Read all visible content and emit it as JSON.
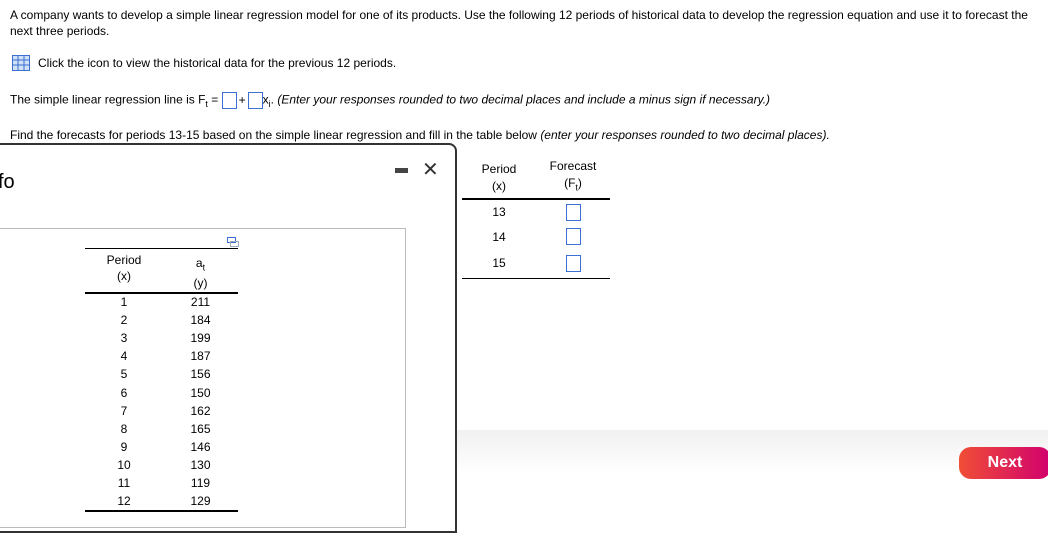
{
  "question": {
    "text": "A company wants to develop a simple linear regression model for one of its products. Use the following 12 periods of historical data to develop the regression equation and use it to forecast the next three periods."
  },
  "data_link": {
    "icon": "table-grid-icon",
    "text": "Click the icon to view the historical data for the previous 12 periods."
  },
  "regression": {
    "prefix": "The simple linear regression line is F",
    "sub_t": "t",
    "equals": " = ",
    "plus": "+",
    "x": "x",
    "sub_i": "i",
    "dot": ".",
    "hint": "(Enter your responses rounded to two decimal places and include a minus sign if necessary.)"
  },
  "forecast_prompt": {
    "text": "Find the forecasts for periods 13-15 based on the simple linear regression and fill in the table below ",
    "hint": "(enter your responses rounded to two decimal places)."
  },
  "forecast_table": {
    "col1": "Period",
    "col1b": "(x)",
    "col2": "Forecast",
    "col2b": "(F",
    "col2sub": "t",
    "col2end": ")",
    "periods": [
      "13",
      "14",
      "15"
    ]
  },
  "popup": {
    "partial_title": "fo",
    "minimize": "-",
    "close": "✕",
    "table": {
      "col1": "Period",
      "col1b": "(x)",
      "col2": "a",
      "col2sub": "t",
      "col2b": "(y)",
      "rows": [
        [
          "1",
          "211"
        ],
        [
          "2",
          "184"
        ],
        [
          "3",
          "199"
        ],
        [
          "4",
          "187"
        ],
        [
          "5",
          "156"
        ],
        [
          "6",
          "150"
        ],
        [
          "7",
          "162"
        ],
        [
          "8",
          "165"
        ],
        [
          "9",
          "146"
        ],
        [
          "10",
          "130"
        ],
        [
          "11",
          "119"
        ],
        [
          "12",
          "129"
        ]
      ]
    }
  },
  "footer": {
    "next_label": "Next"
  }
}
